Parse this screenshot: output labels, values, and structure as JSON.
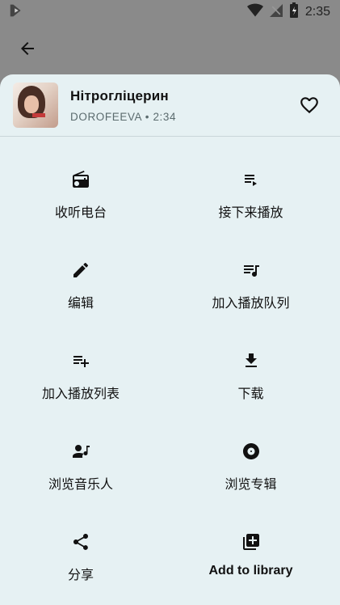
{
  "status": {
    "time": "2:35"
  },
  "song": {
    "title": "Нітрогліцерин",
    "meta": "DOROFEEVA • 2:34"
  },
  "actions": [
    {
      "label": "收听电台",
      "icon": "radio-icon"
    },
    {
      "label": "接下来播放",
      "icon": "play-next-icon"
    },
    {
      "label": "编辑",
      "icon": "edit-pencil-icon"
    },
    {
      "label": "加入播放队列",
      "icon": "queue-music-icon"
    },
    {
      "label": "加入播放列表",
      "icon": "playlist-add-icon"
    },
    {
      "label": "下载",
      "icon": "download-icon"
    },
    {
      "label": "浏览音乐人",
      "icon": "artist-icon"
    },
    {
      "label": "浏览专辑",
      "icon": "album-disc-icon"
    },
    {
      "label": "分享",
      "icon": "share-icon"
    },
    {
      "label": "Add to library",
      "icon": "library-add-icon"
    }
  ],
  "colors": {
    "sheet": "#e6f1f3",
    "scrim": "#8a8a8a",
    "text": "#111111"
  }
}
